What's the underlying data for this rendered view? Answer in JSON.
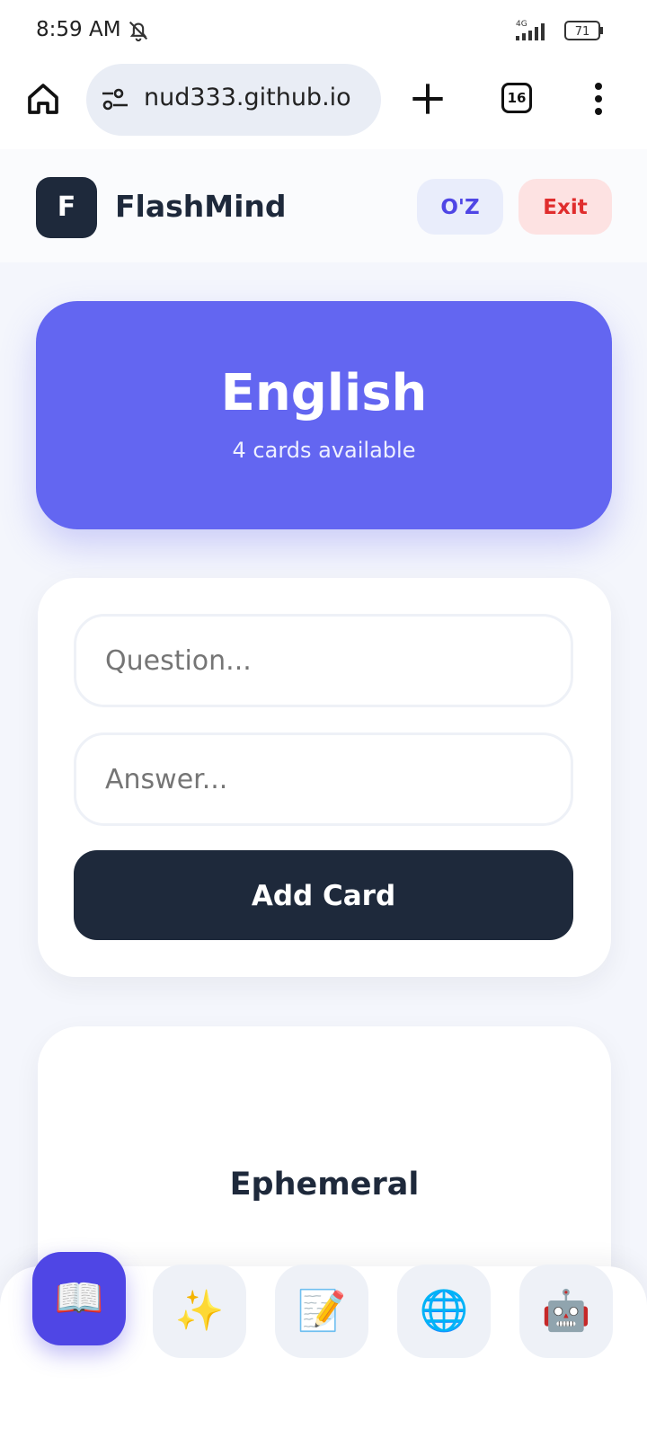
{
  "status_bar": {
    "time": "8:59 AM",
    "network": "4G",
    "battery": "71"
  },
  "browser": {
    "url": "nud333.github.io",
    "tab_count": "16"
  },
  "header": {
    "logo_letter": "F",
    "app_name": "FlashMind",
    "lang_button": "O'Z",
    "exit_button": "Exit"
  },
  "deck": {
    "title": "English",
    "subtitle": "4 cards available"
  },
  "form": {
    "question_placeholder": "Question...",
    "answer_placeholder": "Answer...",
    "add_button": "Add Card"
  },
  "flashcard": {
    "word": "Ephemeral"
  },
  "nav": {
    "items": [
      {
        "icon": "book-icon",
        "glyph": "📖",
        "active": true
      },
      {
        "icon": "sparkles-icon",
        "glyph": "✨",
        "active": false
      },
      {
        "icon": "memo-icon",
        "glyph": "📝",
        "active": false
      },
      {
        "icon": "globe-icon",
        "glyph": "🌐",
        "active": false
      },
      {
        "icon": "robot-icon",
        "glyph": "🤖",
        "active": false
      }
    ]
  },
  "colors": {
    "accent": "#6366f1",
    "primary_dark": "#1e293b",
    "exit_red": "#e02d2d",
    "active_nav": "#4f46e5"
  }
}
